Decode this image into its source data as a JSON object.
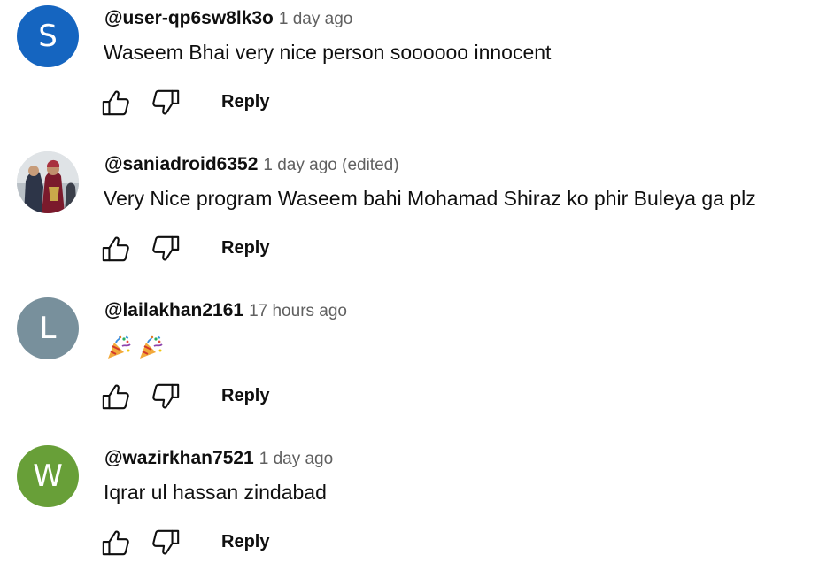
{
  "colors": {
    "avatar_s": "#1565c0",
    "avatar_l": "#78909c",
    "avatar_w": "#689f38",
    "author": "#0f0f0f",
    "time": "#606060"
  },
  "comments": [
    {
      "author": "@user-qp6sw8lk3o",
      "time": "1 day ago",
      "text": "Waseem Bhai very nice person soooooo innocent",
      "avatar_letter": "S",
      "reply_label": "Reply"
    },
    {
      "author": "@saniadroid6352",
      "time": "1 day ago (edited)",
      "text": "Very Nice program Waseem bahi Mohamad Shiraz ko phir Buleya ga plz",
      "avatar_letter": "",
      "reply_label": "Reply"
    },
    {
      "author": "@lailakhan2161",
      "time": "17 hours ago",
      "text": "",
      "emojis": [
        "party-popper-emoji",
        "party-popper-emoji"
      ],
      "avatar_letter": "L",
      "reply_label": "Reply"
    },
    {
      "author": "@wazirkhan7521",
      "time": "1 day ago",
      "text": "Iqrar ul hassan zindabad",
      "avatar_letter": "W",
      "reply_label": "Reply"
    }
  ],
  "icons": {
    "like": "thumbs-up-icon",
    "dislike": "thumbs-down-icon"
  }
}
